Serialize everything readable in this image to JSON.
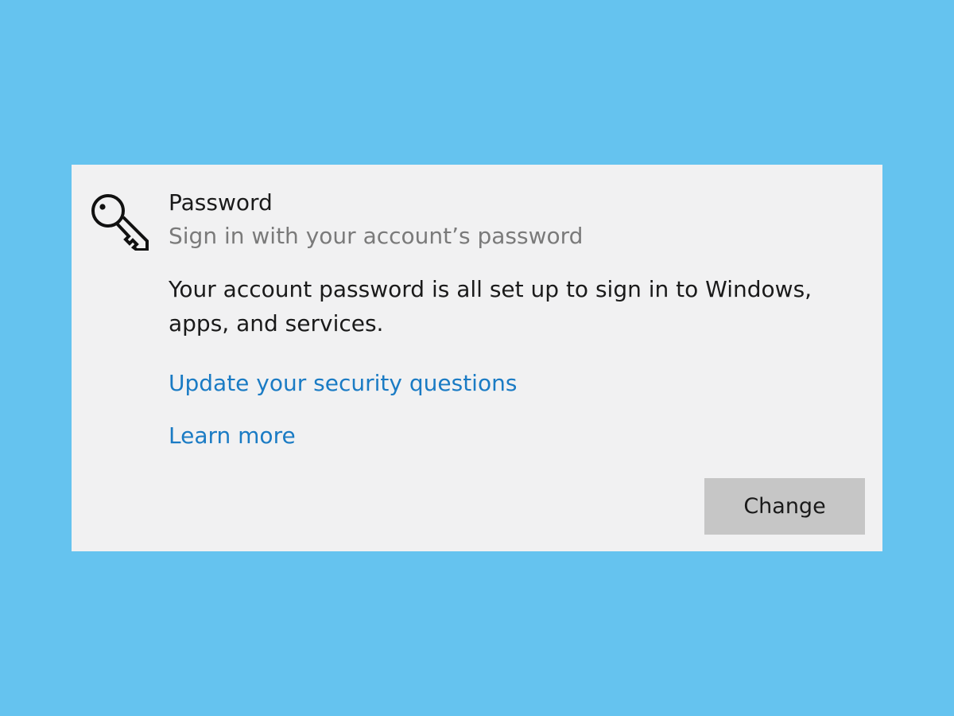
{
  "background_color": "#65c3ef",
  "accent_color": "#1a7bc4",
  "password_panel": {
    "icon": "key-icon",
    "title": "Password",
    "subtitle": "Sign in with your account’s password",
    "description": "Your account password is all set up to sign in to Windows, apps, and services.",
    "links": {
      "security_questions": "Update your security questions",
      "learn_more": "Learn more"
    },
    "change_button_label": "Change"
  }
}
